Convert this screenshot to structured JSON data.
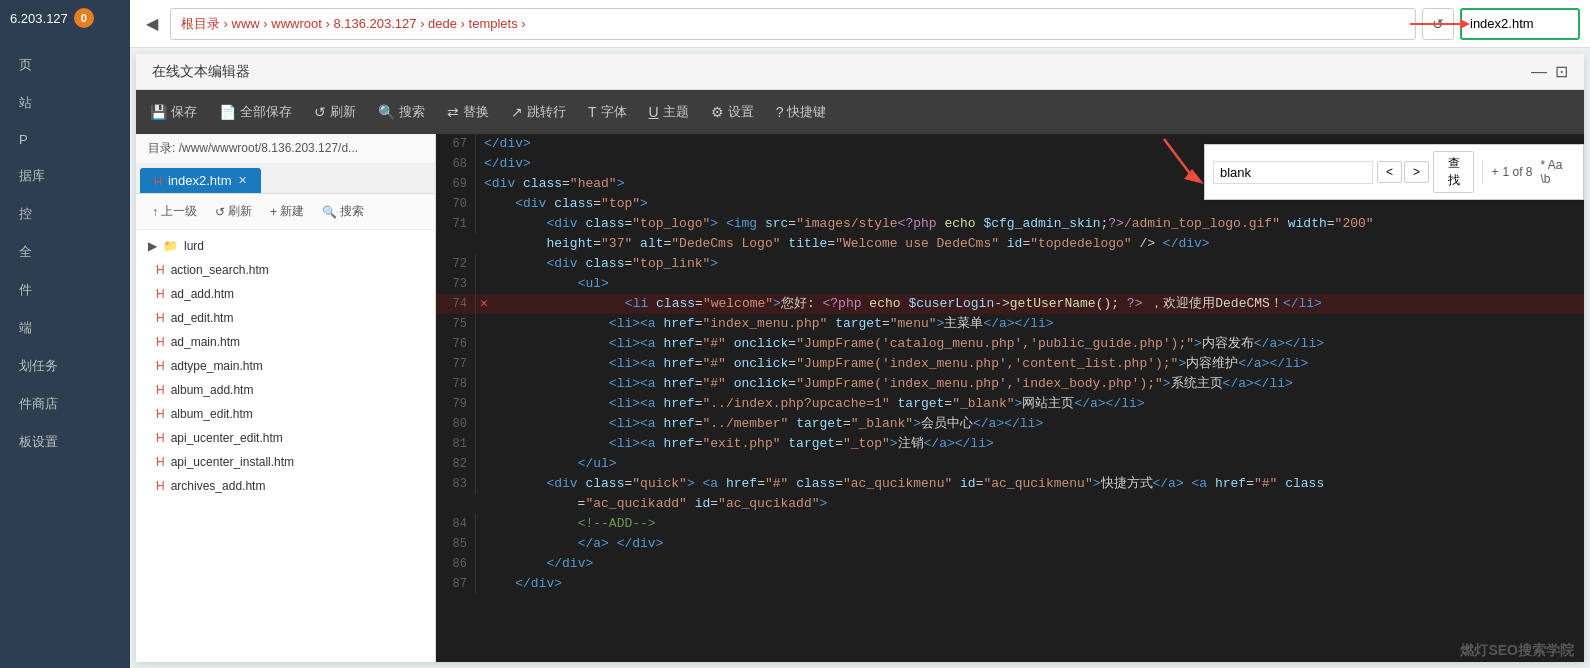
{
  "sidebar": {
    "ip": "6.203.127",
    "badge": "0",
    "items": [
      {
        "label": "页",
        "id": "page"
      },
      {
        "label": "站",
        "id": "site"
      },
      {
        "label": "P",
        "id": "p"
      },
      {
        "label": "据库",
        "id": "database"
      },
      {
        "label": "控",
        "id": "control"
      },
      {
        "label": "全",
        "id": "all"
      },
      {
        "label": "件",
        "id": "component"
      },
      {
        "label": "端",
        "id": "endpoint"
      },
      {
        "label": "划任务",
        "id": "task"
      },
      {
        "label": "件商店",
        "id": "shop"
      },
      {
        "label": "板设置",
        "id": "settings"
      }
    ]
  },
  "topnav": {
    "back_icon": "◀",
    "breadcrumb": "根目录  ›  www  ›  wwwroot  ›  8.136.203.127  ›  dede  ›  templets  ›",
    "refresh_icon": "↺",
    "filename": "index2.htm"
  },
  "editor": {
    "title": "在线文本编辑器",
    "minimize_icon": "—",
    "maximize_icon": "⊡",
    "toolbar": [
      {
        "icon": "💾",
        "label": "保存",
        "id": "save"
      },
      {
        "icon": "📄",
        "label": "全部保存",
        "id": "save-all"
      },
      {
        "icon": "↺",
        "label": "刷新",
        "id": "refresh"
      },
      {
        "icon": "🔍",
        "label": "搜索",
        "id": "search"
      },
      {
        "icon": "⇄",
        "label": "替换",
        "id": "replace"
      },
      {
        "icon": "↗",
        "label": "跳转行",
        "id": "goto"
      },
      {
        "icon": "T",
        "label": "字体",
        "id": "font"
      },
      {
        "icon": "U",
        "label": "主题",
        "id": "theme"
      },
      {
        "icon": "⚙",
        "label": "设置",
        "id": "settings"
      },
      {
        "icon": "?",
        "label": "快捷键",
        "id": "shortcuts"
      }
    ],
    "filepath": "目录: /www/wwwroot/8.136.203.127/d...",
    "filetab": "index2.htm",
    "file_actions": [
      {
        "icon": "↑",
        "label": "上一级",
        "id": "up"
      },
      {
        "icon": "↺",
        "label": "刷新",
        "id": "refresh"
      },
      {
        "icon": "+",
        "label": "新建",
        "id": "new"
      },
      {
        "icon": "🔍",
        "label": "搜索",
        "id": "search"
      }
    ],
    "folders": [
      {
        "name": "lurd",
        "expanded": true
      }
    ],
    "files": [
      "action_search.htm",
      "ad_add.htm",
      "ad_edit.htm",
      "ad_main.htm",
      "adtype_main.htm",
      "album_add.htm",
      "album_edit.htm",
      "api_ucenter_edit.htm",
      "api_ucenter_install.htm",
      "archives_add.htm"
    ],
    "code_lines": [
      {
        "num": "67",
        "content": "    </div>",
        "error": false
      },
      {
        "num": "68",
        "content": "    </div>",
        "error": false
      },
      {
        "num": "69",
        "content": "    <div class=\"head\">",
        "error": false
      },
      {
        "num": "70",
        "content": "        <div class=\"top\">",
        "error": false
      },
      {
        "num": "71",
        "content": "            <div class=\"top_logo\"> <img src=\"images/style<?php echo $cfg_admin_skin;?>/admin_top_logo.gif\" width=\"200\"",
        "error": false
      },
      {
        "num": "",
        "content": "            height=\"37\" alt=\"DedeCms Logo\" title=\"Welcome use DedeCms\" id=\"topdedelogo\" /> </div>",
        "error": false
      },
      {
        "num": "72",
        "content": "            <div class=\"top_link\">",
        "error": false
      },
      {
        "num": "73",
        "content": "                <ul>",
        "error": false
      },
      {
        "num": "74",
        "content": "                    <li class=\"welcome\">您好: <?php echo $cuserLogin->getUserName(); ?> ，欢迎使用DedeCMS！</li>",
        "error": true
      },
      {
        "num": "75",
        "content": "                    <li><a href=\"index_menu.php\" target=\"menu\">主菜单</a></li>",
        "error": false
      },
      {
        "num": "76",
        "content": "                    <li><a href=\"#\" onclick=\"JumpFrame('catalog_menu.php','public_guide.php');\">内容发布</a></li>",
        "error": false
      },
      {
        "num": "77",
        "content": "                    <li><a href=\"#\" onclick=\"JumpFrame('index_menu.php','content_list.php');\">内容维护</a></li>",
        "error": false
      },
      {
        "num": "78",
        "content": "                    <li><a href=\"#\" onclick=\"JumpFrame('index_menu.php','index_body.php');\">系统主页</a></li>",
        "error": false
      },
      {
        "num": "79",
        "content": "                    <li><a href=\"../index.php?upcache=1\" target=\"_blank\">网站主页</a></li>",
        "error": false
      },
      {
        "num": "80",
        "content": "                    <li><a href=\"../member\" target=\"_blank\">会员中心</a></li>",
        "error": false
      },
      {
        "num": "81",
        "content": "                    <li><a href=\"exit.php\" target=\"_top\">注销</a></li>",
        "error": false
      },
      {
        "num": "82",
        "content": "                </ul>",
        "error": false
      },
      {
        "num": "83",
        "content": "            <div class=\"quick\"> <a href=\"#\" class=\"ac_qucikmenu\" id=\"ac_qucikmenu\">快捷方式</a> <a href=\"#\" class",
        "error": false
      },
      {
        "num": "",
        "content": "                =\"ac_qucikadd\" id=\"ac_qucikadd\">",
        "error": false
      },
      {
        "num": "84",
        "content": "                <!--ADD-->",
        "error": false
      },
      {
        "num": "85",
        "content": "                </a> </div>",
        "error": false
      },
      {
        "num": "86",
        "content": "            </div>",
        "error": false
      },
      {
        "num": "87",
        "content": "        </div>",
        "error": false
      }
    ],
    "search_popup": {
      "value": "blank",
      "count": "1 of 8",
      "find_label": "查找",
      "options": "+ * Aa \\b"
    }
  },
  "watermark": "燃灯SEO搜索学院"
}
